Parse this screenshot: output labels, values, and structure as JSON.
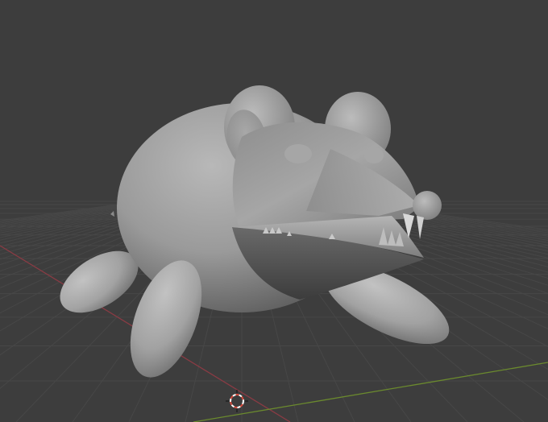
{
  "viewport": {
    "background": "#3d3d3d",
    "grid_color": "#474747",
    "x_axis_color": "#8a3b44",
    "y_axis_color": "#6b8a2e"
  },
  "scene": {
    "object": "rat-creature-mesh",
    "shading": "solid",
    "mesh_color": "#9a9a9a"
  },
  "cursor": {
    "icon": "3d-cursor-icon",
    "ring_color_a": "#d94a3c",
    "ring_color_b": "#ffffff"
  }
}
